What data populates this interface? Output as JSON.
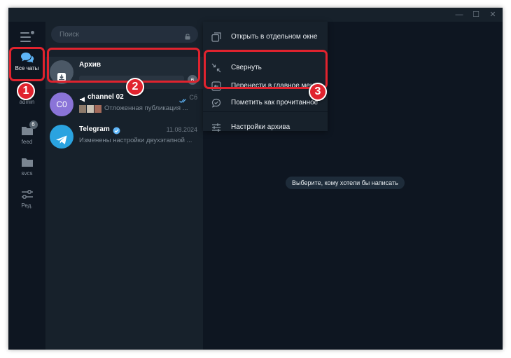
{
  "window": {
    "controls": {
      "minimize": "—",
      "maximize": "☐",
      "close": "✕"
    }
  },
  "rail": {
    "items": [
      {
        "label": "Все чаты",
        "icon": "chat-bubbles-icon"
      },
      {
        "label": "admin",
        "icon": "folder-icon"
      },
      {
        "label": "feed",
        "icon": "folder-icon",
        "badge": "6"
      },
      {
        "label": "svcs",
        "icon": "folder-icon"
      },
      {
        "label": "Ред.",
        "icon": "sliders-icon"
      }
    ]
  },
  "search": {
    "placeholder": "Поиск"
  },
  "chats": [
    {
      "title": "Архив",
      "unread": "6",
      "avatar_color": "#4b5866",
      "icon": "archive-icon"
    },
    {
      "title": "channel 02",
      "time": "Сб",
      "avatar_text": "C0",
      "avatar_color": "#8a74d8",
      "preview": "Отложенная публикация ...",
      "icon": "megaphone-icon"
    },
    {
      "title": "Telegram",
      "time": "11.08.2024",
      "preview": "Изменены настройки двухэтапной ...",
      "avatar_color": "#2aa3e0",
      "icon": "telegram-logo-icon"
    }
  ],
  "context_menu": {
    "items": [
      {
        "label": "Открыть в отдельном окне",
        "icon": "open-window-icon"
      },
      {
        "label": "Свернуть",
        "icon": "collapse-icon"
      },
      {
        "label": "Перенести в главное меню",
        "icon": "move-to-menu-icon"
      },
      {
        "label": "Пометить как прочитанное",
        "icon": "read-check-icon"
      },
      {
        "label": "Настройки архива",
        "icon": "settings-sliders-icon"
      }
    ]
  },
  "main": {
    "empty_text": "Выберите, кому хотели бы написать"
  },
  "annotations": {
    "markers": [
      "1",
      "2",
      "3"
    ],
    "color": "#e0232e"
  },
  "colors": {
    "sidebar_bg": "#17212b",
    "rail_bg": "#0e1621",
    "accent": "#5eb5f7"
  }
}
